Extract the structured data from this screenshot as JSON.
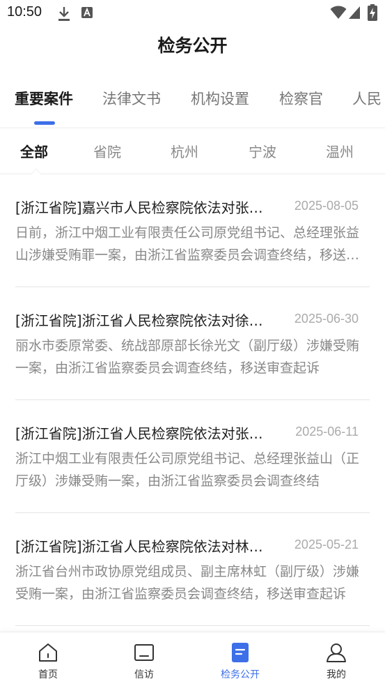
{
  "status_bar": {
    "time": "10:50",
    "left_icons": [
      "download-icon",
      "a-box-icon"
    ],
    "right_icons": [
      "wifi-icon",
      "signal-icon",
      "battery-charging-icon"
    ]
  },
  "header": {
    "title": "检务公开"
  },
  "main_tabs": [
    {
      "label": "重要案件",
      "active": true
    },
    {
      "label": "法律文书",
      "active": false
    },
    {
      "label": "机构设置",
      "active": false
    },
    {
      "label": "检察官",
      "active": false
    },
    {
      "label": "人民",
      "active": false
    }
  ],
  "sub_tabs": [
    {
      "label": "全部",
      "active": true
    },
    {
      "label": "省院",
      "active": false
    },
    {
      "label": "杭州",
      "active": false
    },
    {
      "label": "宁波",
      "active": false
    },
    {
      "label": "温州",
      "active": false
    }
  ],
  "cases": [
    {
      "title": "[浙江省院]嘉兴市人民检察院依法对张益山涉嫌受贿案提起公诉",
      "date": "2025-08-05",
      "summary": "日前，浙江中烟工业有限责任公司原党组书记、总经理张益山涉嫌受贿罪一案，由浙江省监察委员会调查终结，移送审查起诉"
    },
    {
      "title": "[浙江省院]浙江省人民检察院依法对徐光文决定逮捕",
      "date": "2025-06-30",
      "summary": "丽水市委原常委、统战部原部长徐光文（副厅级）涉嫌受贿一案，由浙江省监察委员会调查终结，移送审查起诉"
    },
    {
      "title": "[浙江省院]浙江省人民检察院依法对张益山决定逮捕",
      "date": "2025-06-11",
      "summary": "浙江中烟工业有限责任公司原党组书记、总经理张益山（正厅级）涉嫌受贿一案，由浙江省监察委员会调查终结"
    },
    {
      "title": "[浙江省院]浙江省人民检察院依法对林虹决定逮捕",
      "date": "2025-05-21",
      "summary": "浙江省台州市政协原党组成员、副主席林虹（副厅级）涉嫌受贿一案，由浙江省监察委员会调查终结，移送审查起诉"
    }
  ],
  "bottom_nav": [
    {
      "label": "首页",
      "icon": "home-icon",
      "active": false
    },
    {
      "label": "信访",
      "icon": "monitor-icon",
      "active": false
    },
    {
      "label": "检务公开",
      "icon": "document-icon",
      "active": true
    },
    {
      "label": "我的",
      "icon": "user-icon",
      "active": false
    }
  ],
  "colors": {
    "accent": "#3d6fe8",
    "text": "#1f1f1f",
    "muted": "#888888"
  }
}
